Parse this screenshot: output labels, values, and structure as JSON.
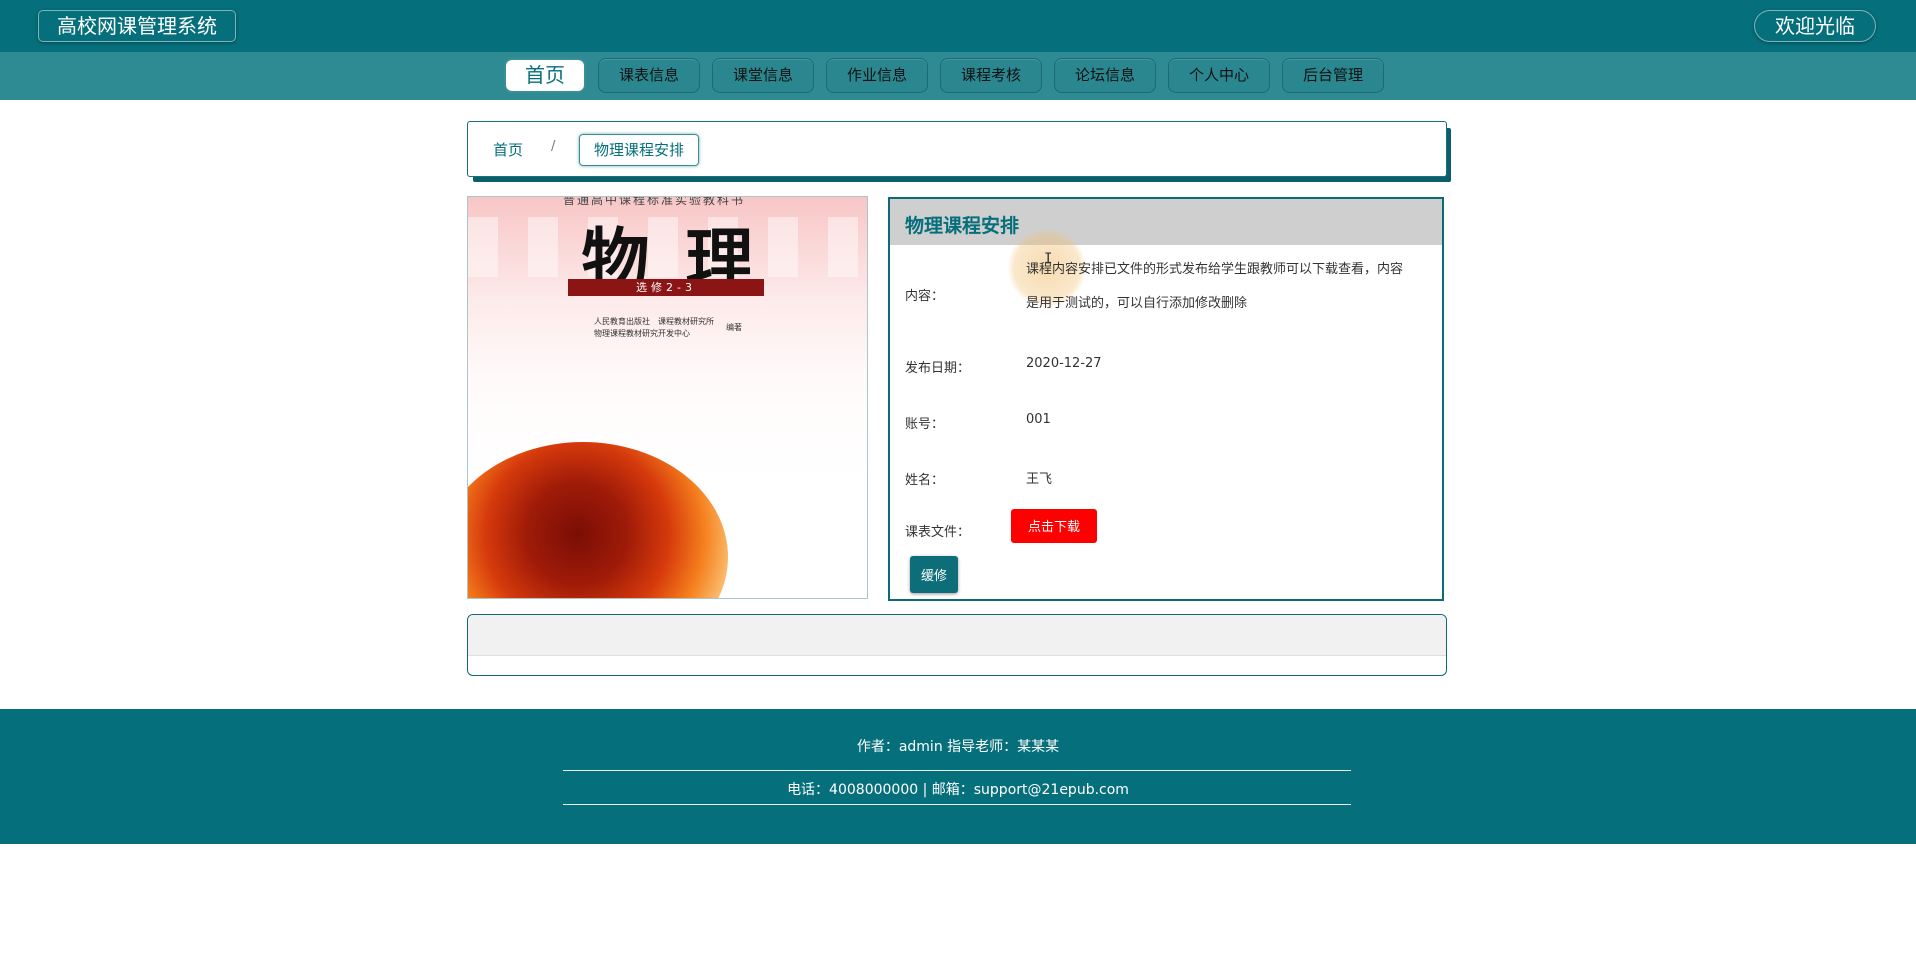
{
  "header": {
    "brand": "高校网课管理系统",
    "welcome": "欢迎光临"
  },
  "nav": {
    "items": [
      {
        "label": "首页"
      },
      {
        "label": "课表信息"
      },
      {
        "label": "课堂信息"
      },
      {
        "label": "作业信息"
      },
      {
        "label": "课程考核"
      },
      {
        "label": "论坛信息"
      },
      {
        "label": "个人中心"
      },
      {
        "label": "后台管理"
      }
    ]
  },
  "breadcrumb": {
    "home": "首页",
    "separator": "/",
    "current": "物理课程安排"
  },
  "cover": {
    "top_line": "普通高中课程标准实验教科书",
    "title": "物理",
    "subtitle": "选修2-3",
    "publisher_line1": "人民教育出版社　课程教材研究所",
    "publisher_line2": "物理课程教材研究开发中心",
    "publisher_tag": "编著"
  },
  "detail": {
    "title": "物理课程安排",
    "content_label": "内容：",
    "content_value": "课程内容安排已文件的形式发布给学生跟教师可以下载查看，内容是用于测试的，可以自行添加修改删除",
    "date_label": "发布日期：",
    "date_value": "2020-12-27",
    "account_label": "账号：",
    "account_value": "001",
    "name_label": "姓名：",
    "name_value": "王飞",
    "file_label": "课表文件：",
    "download_label": "点击下载",
    "edit_label": "缓修"
  },
  "footer": {
    "line1": "作者：admin 指导老师：某某某",
    "line2": "电话：4008000000 | 邮箱：support@21epub.com"
  },
  "colors": {
    "primary": "#056f7b",
    "nav_bg": "#2e8a93",
    "download": "#ff0000"
  }
}
